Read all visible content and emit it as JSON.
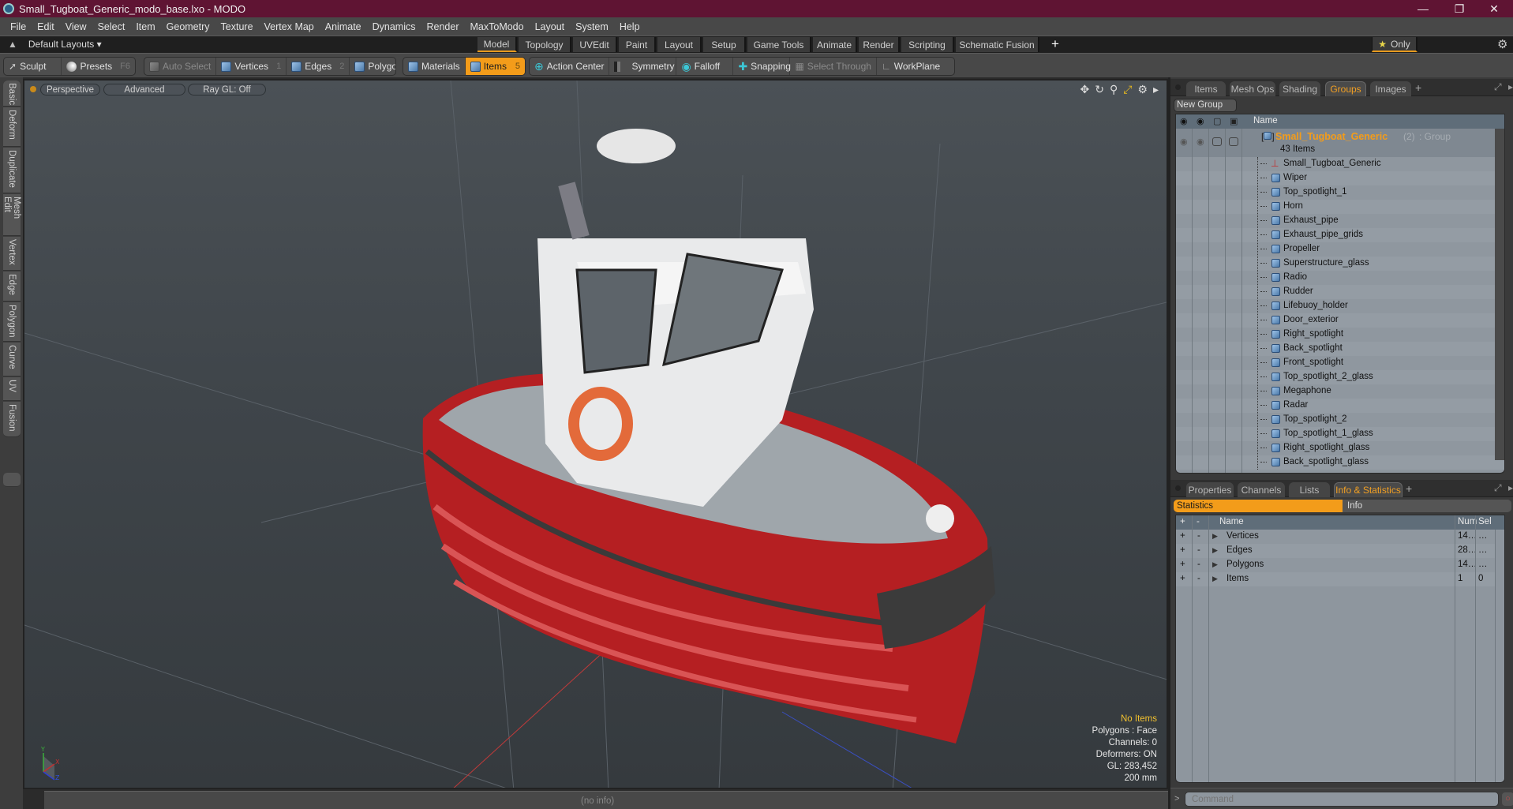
{
  "window": {
    "title": "Small_Tugboat_Generic_modo_base.lxo - MODO",
    "controls": [
      "minimize-icon",
      "restore-icon",
      "close-icon"
    ]
  },
  "menu": [
    "File",
    "Edit",
    "View",
    "Select",
    "Item",
    "Geometry",
    "Texture",
    "Vertex Map",
    "Animate",
    "Dynamics",
    "Render",
    "MaxToModo",
    "Layout",
    "System",
    "Help"
  ],
  "layout_bar": {
    "layouts_label": "Default Layouts",
    "workspace_tabs": [
      "Model",
      "Topology",
      "UVEdit",
      "Paint",
      "Layout",
      "Setup",
      "Game Tools",
      "Animate",
      "Render",
      "Scripting",
      "Schematic Fusion"
    ],
    "active_tab": "Model",
    "add_tab": "+",
    "only_label": "Only"
  },
  "toolbar": {
    "sculpt": "Sculpt",
    "presets": "Presets",
    "presets_key": "F6",
    "auto_select": "Auto Select",
    "vertices": "Vertices",
    "vertices_key": "1",
    "edges": "Edges",
    "edges_key": "2",
    "polygons": "Polygons",
    "materials": "Materials",
    "items": "Items",
    "items_key": "5",
    "action_center": "Action Center",
    "symmetry": "Symmetry",
    "falloff": "Falloff",
    "snapping": "Snapping",
    "select_through": "Select Through",
    "workplane": "WorkPlane"
  },
  "left_tabs": [
    "Basic",
    "Deform",
    "Duplicate",
    "Mesh Edit",
    "Vertex",
    "Edge",
    "Polygon",
    "Curve",
    "UV",
    "Fusion"
  ],
  "viewport": {
    "view_mode": "Perspective",
    "shading": "Advanced",
    "raygl": "Ray GL: Off",
    "hud": {
      "selection": "No Items",
      "polygons": "Polygons : Face",
      "channels": "Channels: 0",
      "deformers": "Deformers: ON",
      "gl": "GL: 283,452",
      "grid": "200 mm"
    },
    "axis": {
      "y": "Y",
      "x": "X",
      "z": "Z"
    }
  },
  "status": {
    "info": "(no info)"
  },
  "groups_panel": {
    "tabs": [
      "Items",
      "Mesh Ops",
      "Shading",
      "Groups",
      "Images"
    ],
    "active_tab": "Groups",
    "new_group": "New Group",
    "column_name": "Name",
    "group": {
      "name": "Small_Tugboat_Generic",
      "count": "(2)",
      "type": ": Group",
      "items": "43 Items"
    },
    "items": [
      "Small_Tugboat_Generic",
      "Wiper",
      "Top_spotlight_1",
      "Horn",
      "Exhaust_pipe",
      "Exhaust_pipe_grids",
      "Propeller",
      "Superstructure_glass",
      "Radio",
      "Rudder",
      "Lifebuoy_holder",
      "Door_exterior",
      "Right_spotlight",
      "Back_spotlight",
      "Front_spotlight",
      "Top_spotlight_2_glass",
      "Megaphone",
      "Radar",
      "Top_spotlight_2",
      "Top_spotlight_1_glass",
      "Right_spotlight_glass",
      "Back_spotlight_glass"
    ]
  },
  "info_panel": {
    "tabs": [
      "Properties",
      "Channels",
      "Lists",
      "Info & Statistics"
    ],
    "active_tab": "Info & Statistics",
    "subtabs": [
      "Statistics",
      "Info"
    ],
    "columns": {
      "plus": "+",
      "minus": "-",
      "name": "Name",
      "num": "Num",
      "sel": "Sel"
    },
    "rows": [
      {
        "name": "Vertices",
        "num": "14…",
        "sel": "…"
      },
      {
        "name": "Edges",
        "num": "28…",
        "sel": "…"
      },
      {
        "name": "Polygons",
        "num": "14…",
        "sel": "…"
      },
      {
        "name": "Items",
        "num": "1",
        "sel": "0"
      }
    ]
  },
  "command": {
    "placeholder": "Command",
    "prompt": ">"
  },
  "colors": {
    "accent": "#f39c1a",
    "titlebar": "#5f1433",
    "hud_highlight": "#f2c12e",
    "group_name": "#f39c1a"
  }
}
